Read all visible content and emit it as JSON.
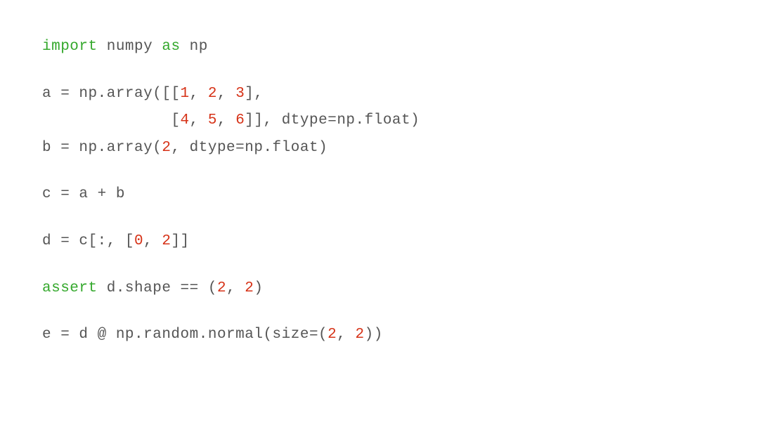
{
  "lines": {
    "l1_import": "import",
    "l1_numpy": " numpy ",
    "l1_as": "as",
    "l1_np": " np",
    "l3_pre": "a = np.array([[",
    "l3_n1": "1",
    "l3_c1": ", ",
    "l3_n2": "2",
    "l3_c2": ", ",
    "l3_n3": "3",
    "l3_post": "],",
    "l4_pre": "              [",
    "l4_n1": "4",
    "l4_c1": ", ",
    "l4_n2": "5",
    "l4_c2": ", ",
    "l4_n3": "6",
    "l4_post": "]], dtype=np.float)",
    "l5_pre": "b = np.array(",
    "l5_n1": "2",
    "l5_post": ", dtype=np.float)",
    "l7": "c = a + b",
    "l9_pre": "d = c[:, [",
    "l9_n1": "0",
    "l9_c1": ", ",
    "l9_n2": "2",
    "l9_post": "]]",
    "l11_assert": "assert",
    "l11_mid": " d.shape == (",
    "l11_n1": "2",
    "l11_c1": ", ",
    "l11_n2": "2",
    "l11_post": ")",
    "l13_pre": "e = d @ np.random.normal(size=(",
    "l13_n1": "2",
    "l13_c1": ", ",
    "l13_n2": "2",
    "l13_post": "))"
  }
}
